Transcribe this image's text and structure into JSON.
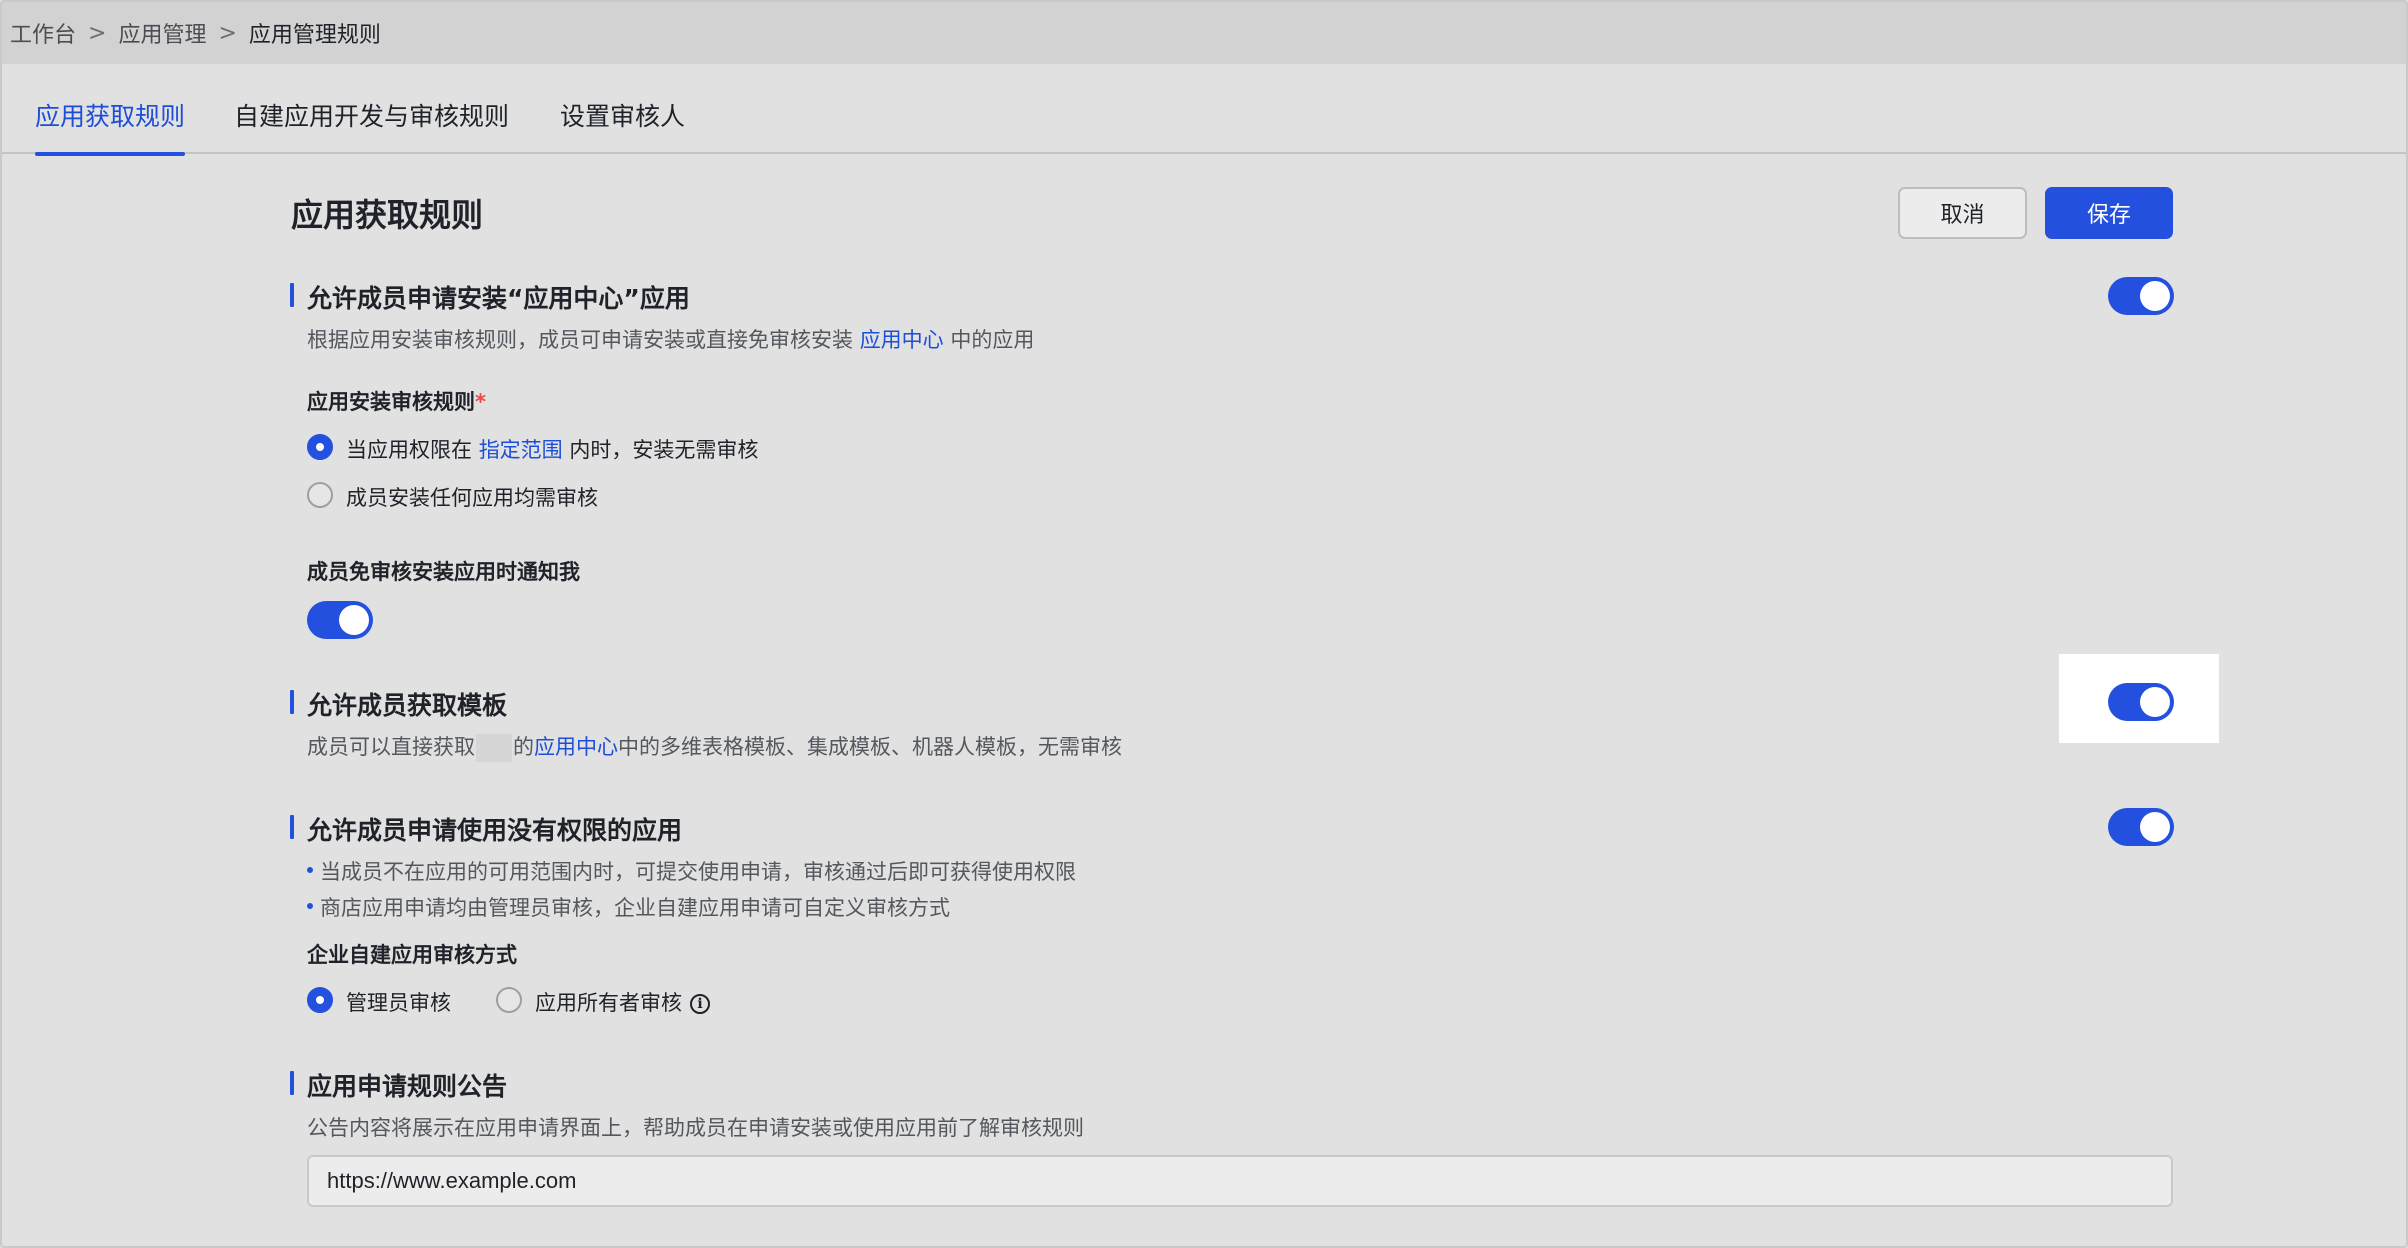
{
  "breadcrumb": {
    "items": [
      "工作台",
      "应用管理",
      "应用管理规则"
    ],
    "separator": ">"
  },
  "tabs": [
    "应用获取规则",
    "自建应用开发与审核规则",
    "设置审核人"
  ],
  "active_tab": 0,
  "page": {
    "title": "应用获取规则",
    "cancel_label": "取消",
    "save_label": "保存"
  },
  "section1": {
    "title": "允许成员申请安装“应用中心”应用",
    "toggle_on": true,
    "desc_before": "根据应用安装审核规则，成员可申请安装或直接免审核安装 ",
    "desc_link": "应用中心",
    "desc_after": " 中的应用",
    "rule_label": "应用安装审核规则",
    "required_mark": "*",
    "option1_before": "当应用权限在 ",
    "option1_link": "指定范围",
    "option1_after": " 内时，安装无需审核",
    "option1_checked": true,
    "option2": "成员安装任何应用均需审核",
    "option2_checked": false,
    "notify_label": "成员免审核安装应用时通知我",
    "notify_on": true
  },
  "section2": {
    "title": "允许成员获取模板",
    "toggle_on": true,
    "desc_before": "成员可以直接获取",
    "desc_partial": "的",
    "desc_link": "应用中心",
    "desc_after": "中的多维表格模板、集成模板、机器人模板，无需审核"
  },
  "section3": {
    "title": "允许成员申请使用没有权限的应用",
    "toggle_on": true,
    "bullets": [
      "当成员不在应用的可用范围内时，可提交使用申请，审核通过后即可获得使用权限",
      "商店应用申请均由管理员审核，企业自建应用申请可自定义审核方式"
    ],
    "method_label": "企业自建应用审核方式",
    "method_option1": "管理员审核",
    "method_option1_checked": true,
    "method_option2": "应用所有者审核",
    "method_option2_checked": false,
    "info_icon_glyph": "i"
  },
  "section4": {
    "title": "应用申请规则公告",
    "desc": "公告内容将展示在应用申请界面上，帮助成员在申请安装或使用应用前了解审核规则",
    "input_value": "https://www.example.com"
  },
  "colors": {
    "accent": "#2450e0",
    "link": "#1d4ed8",
    "required": "#e5484d"
  }
}
